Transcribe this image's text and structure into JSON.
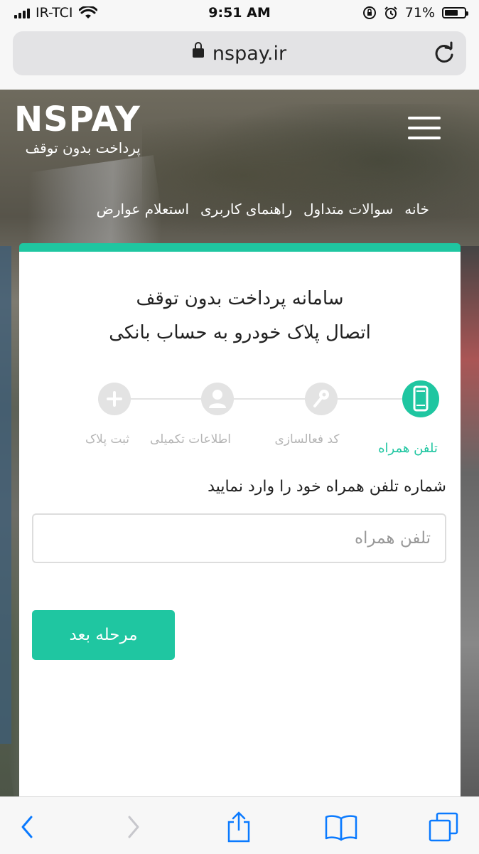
{
  "status_bar": {
    "carrier": "IR-TCI",
    "time": "9:51 AM",
    "battery_percent": "71%",
    "battery_level": 0.71,
    "icons": [
      "signal-icon",
      "wifi-icon",
      "orientation-lock-icon",
      "alarm-icon",
      "battery-icon"
    ]
  },
  "browser": {
    "url": "nspay.ir",
    "icons": [
      "lock-icon",
      "reload-icon"
    ]
  },
  "header": {
    "logo_text": "NSPAY",
    "logo_subtitle": "پرداخت بدون توقف",
    "nav": [
      {
        "label": "خانه"
      },
      {
        "label": "سوالات متداول"
      },
      {
        "label": "راهنمای کاربری"
      },
      {
        "label": "استعلام عوارض"
      }
    ]
  },
  "card": {
    "title_line1": "سامانه پرداخت بدون توقف",
    "title_line2": "اتصال پلاک خودرو به حساب بانکی",
    "steps": [
      {
        "label": "تلفن همراه",
        "icon": "mobile-phone-icon",
        "active": true
      },
      {
        "label": "کد فعالسازی",
        "icon": "key-icon",
        "active": false
      },
      {
        "label": "اطلاعات تکمیلی",
        "icon": "user-icon",
        "active": false
      },
      {
        "label": "ثبت پلاک",
        "icon": "plus-icon",
        "active": false
      }
    ],
    "prompt": "شماره تلفن همراه خود را وارد نمایید",
    "phone_value": "",
    "phone_placeholder": "تلفن همراه",
    "next_button": "مرحله بعد"
  },
  "toolbar": {
    "icons": [
      "back-arrow-icon",
      "forward-arrow-icon",
      "share-icon",
      "bookmarks-icon",
      "tabs-icon"
    ]
  },
  "colors": {
    "accent": "#1fc6a1",
    "step_inactive": "#e3e3e3",
    "toolbar_blue": "#0a7aff"
  }
}
